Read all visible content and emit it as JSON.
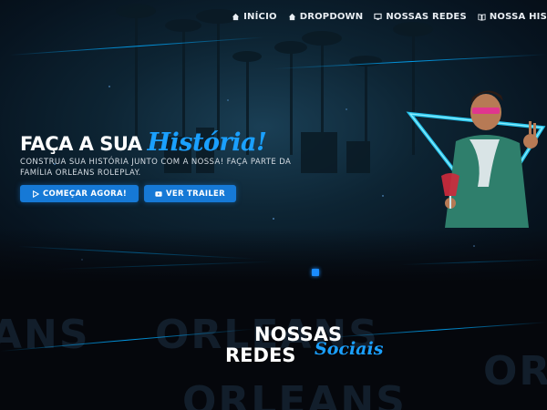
{
  "nav": {
    "items": [
      {
        "label": "INÍCIO",
        "icon": "home-icon"
      },
      {
        "label": "DROPDOWN",
        "icon": "home-icon"
      },
      {
        "label": "NOSSAS REDES",
        "icon": "monitor-icon"
      },
      {
        "label": "NOSSA HIS",
        "icon": "book-icon"
      }
    ]
  },
  "hero": {
    "title_main": "FAÇA A SUA",
    "title_script": "História!",
    "subtitle": "CONSTRUA SUA HISTÓRIA JUNTO COM A NOSSA! FAÇA PARTE DA FAMÍLIA ORLEANS ROLEPLAY.",
    "buttons": {
      "start": {
        "label": "COMEÇAR AGORA!",
        "icon": "play-icon"
      },
      "trailer": {
        "label": "VER TRAILER",
        "icon": "video-icon"
      }
    }
  },
  "social_section": {
    "title_line1": "NOSSAS",
    "title_line2": "REDES",
    "title_script": "Sociais",
    "background_words": [
      "ANS",
      "ORLEANS",
      "OR",
      "ORLEANS"
    ]
  },
  "colors": {
    "accent": "#1a8cff",
    "button": "#1679d6",
    "background": "#05070c"
  }
}
